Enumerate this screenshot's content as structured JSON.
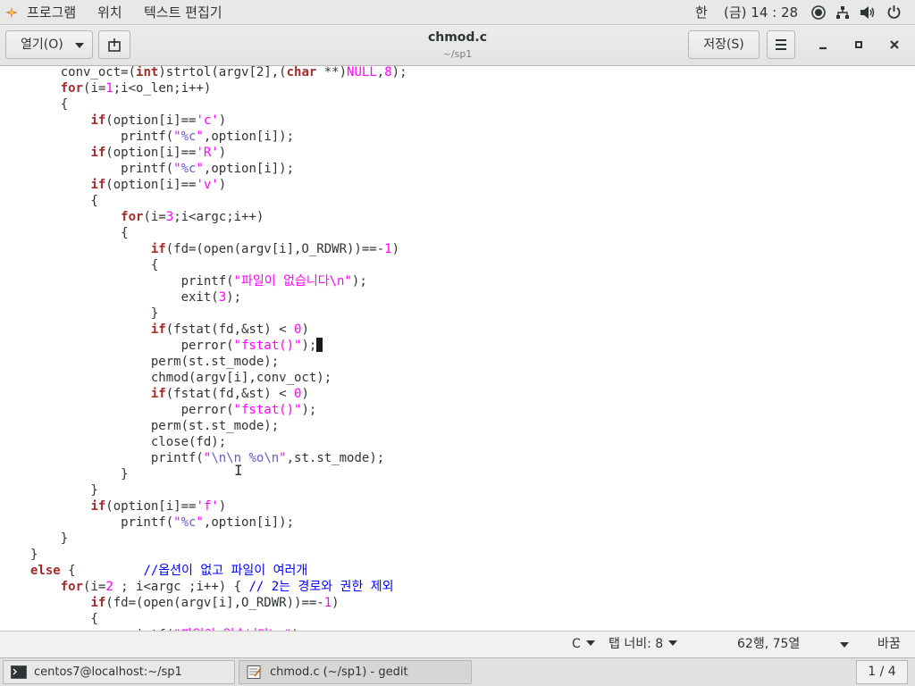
{
  "top_panel": {
    "apps_menu": "프로그램",
    "places_menu": "위치",
    "app_menu": "텍스트 편집기",
    "input_method": "한",
    "clock": "(금) 14 : 28",
    "icons": [
      "record-icon",
      "network-icon",
      "volume-icon",
      "power-icon"
    ]
  },
  "header": {
    "open_label": "열기(O)",
    "title": "chmod.c",
    "subtitle": "~/sp1",
    "save_label": "저장(S)"
  },
  "editor": {
    "lines": [
      [
        [
          "    conv_oct=(",
          ""
        ],
        [
          "int",
          "kw"
        ],
        [
          ")strtol(argv[2],(",
          ""
        ],
        [
          "char",
          "kw"
        ],
        [
          " **)",
          ""
        ],
        [
          "NULL",
          "str"
        ],
        [
          ",",
          ""
        ],
        [
          "8",
          "num"
        ],
        [
          ");",
          ""
        ]
      ],
      [
        [
          "    ",
          ""
        ],
        [
          "for",
          "kw"
        ],
        [
          "(i=",
          ""
        ],
        [
          "1",
          "num"
        ],
        [
          ";i<o_len;i++)",
          ""
        ]
      ],
      [
        [
          "    {",
          ""
        ]
      ],
      [
        [
          "        ",
          ""
        ],
        [
          "if",
          "kw"
        ],
        [
          "(option[i]==",
          ""
        ],
        [
          "'c'",
          "str"
        ],
        [
          ")",
          ""
        ]
      ],
      [
        [
          "            printf(",
          ""
        ],
        [
          "\"",
          "str"
        ],
        [
          "%c",
          "esc"
        ],
        [
          "\"",
          "str"
        ],
        [
          ",option[i]);",
          ""
        ]
      ],
      [
        [
          "        ",
          ""
        ],
        [
          "if",
          "kw"
        ],
        [
          "(option[i]==",
          ""
        ],
        [
          "'R'",
          "str"
        ],
        [
          ")",
          ""
        ]
      ],
      [
        [
          "            printf(",
          ""
        ],
        [
          "\"",
          "str"
        ],
        [
          "%c",
          "esc"
        ],
        [
          "\"",
          "str"
        ],
        [
          ",option[i]);",
          ""
        ]
      ],
      [
        [
          "        ",
          ""
        ],
        [
          "if",
          "kw"
        ],
        [
          "(option[i]==",
          ""
        ],
        [
          "'v'",
          "str"
        ],
        [
          ")",
          ""
        ]
      ],
      [
        [
          "        {",
          ""
        ]
      ],
      [
        [
          "            ",
          ""
        ],
        [
          "for",
          "kw"
        ],
        [
          "(i=",
          ""
        ],
        [
          "3",
          "num"
        ],
        [
          ";i<argc;i++)",
          ""
        ]
      ],
      [
        [
          "            {",
          ""
        ]
      ],
      [
        [
          "                ",
          ""
        ],
        [
          "if",
          "kw"
        ],
        [
          "(fd=(open(argv[i],O_RDWR))==-",
          ""
        ],
        [
          "1",
          "num"
        ],
        [
          ")",
          ""
        ]
      ],
      [
        [
          "                {",
          ""
        ]
      ],
      [
        [
          "                    printf(",
          ""
        ],
        [
          "\"파일이 없습니다\\n\"",
          "str"
        ],
        [
          ");",
          ""
        ]
      ],
      [
        [
          "                    exit(",
          ""
        ],
        [
          "3",
          "num"
        ],
        [
          ");",
          ""
        ]
      ],
      [
        [
          "                }",
          ""
        ]
      ],
      [
        [
          "                ",
          ""
        ],
        [
          "if",
          "kw"
        ],
        [
          "(fstat(fd,&st) < ",
          ""
        ],
        [
          "0",
          "num"
        ],
        [
          ")",
          ""
        ]
      ],
      [
        [
          "                    perror(",
          ""
        ],
        [
          "\"fstat()\"",
          "str"
        ],
        [
          ");",
          ""
        ],
        [
          "",
          "cursor"
        ]
      ],
      [
        [
          "                perm(st.st_mode);",
          ""
        ]
      ],
      [
        [
          "                chmod(argv[i],conv_oct);",
          ""
        ]
      ],
      [
        [
          "                ",
          ""
        ],
        [
          "if",
          "kw"
        ],
        [
          "(fstat(fd,&st) < ",
          ""
        ],
        [
          "0",
          "num"
        ],
        [
          ")",
          ""
        ]
      ],
      [
        [
          "                    perror(",
          ""
        ],
        [
          "\"fstat()\"",
          "str"
        ],
        [
          ");",
          ""
        ]
      ],
      [
        [
          "                perm(st.st_mode);",
          ""
        ]
      ],
      [
        [
          "                close(fd);",
          ""
        ]
      ],
      [
        [
          "                printf(",
          ""
        ],
        [
          "\"",
          "str"
        ],
        [
          "\\n\\n %o\\n",
          "esc"
        ],
        [
          "\"",
          "str"
        ],
        [
          ",st.st_mode);",
          ""
        ]
      ],
      [
        [
          "            }",
          ""
        ]
      ],
      [
        [
          "        }",
          ""
        ]
      ],
      [
        [
          "        ",
          ""
        ],
        [
          "if",
          "kw"
        ],
        [
          "(option[i]==",
          ""
        ],
        [
          "'f'",
          "str"
        ],
        [
          ")",
          ""
        ]
      ],
      [
        [
          "            printf(",
          ""
        ],
        [
          "\"",
          "str"
        ],
        [
          "%c",
          "esc"
        ],
        [
          "\"",
          "str"
        ],
        [
          ",option[i]);",
          ""
        ]
      ],
      [
        [
          "    }",
          ""
        ]
      ],
      [
        [
          "}",
          ""
        ]
      ],
      [
        [
          "",
          ""
        ],
        [
          "else",
          "kw"
        ],
        [
          " {         ",
          ""
        ],
        [
          "//옵션이 없고 파일이 여러개",
          "cmt"
        ]
      ],
      [
        [
          "    ",
          ""
        ],
        [
          "for",
          "kw"
        ],
        [
          "(i=",
          ""
        ],
        [
          "2",
          "num"
        ],
        [
          " ; i<argc ;i++) { ",
          ""
        ],
        [
          "// 2는 경로와 권한 제외",
          "cmt"
        ]
      ],
      [
        [
          "        ",
          ""
        ],
        [
          "if",
          "kw"
        ],
        [
          "(fd=(open(argv[i],O_RDWR))==-",
          ""
        ],
        [
          "1",
          "num"
        ],
        [
          ")",
          ""
        ]
      ],
      [
        [
          "        {",
          ""
        ]
      ],
      [
        [
          "            printf(",
          ""
        ],
        [
          "\"파일이 없습니다\\n\"",
          "str"
        ],
        [
          ");",
          ""
        ]
      ]
    ]
  },
  "statusbar": {
    "language": "C",
    "tab_width": "탭 너비: 8",
    "position": "62행, 75열",
    "mode": "바꿈"
  },
  "taskbar": {
    "terminal_label": "centos7@localhost:~/sp1",
    "gedit_label": "chmod.c (~/sp1) - gedit",
    "workspace": "1 / 4"
  }
}
